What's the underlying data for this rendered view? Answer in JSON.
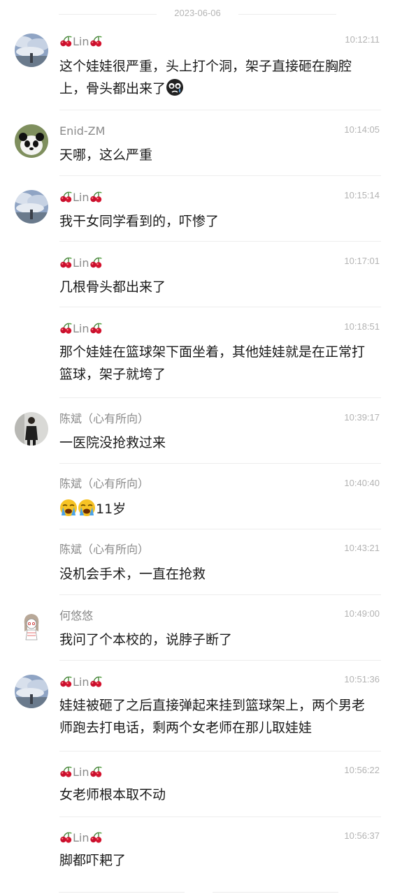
{
  "date_separator": "2023-06-06",
  "messages": [
    {
      "sender": "Lin",
      "time": "10:12:11",
      "avatar": "cloud-landscape-avatar",
      "text": "这个娃娃很严重，头上打个洞，架子直接砸在胸腔上，骨头都出来了",
      "emoji": "crying-face-emoji"
    },
    {
      "sender": "Enid-ZM",
      "time": "10:14:05",
      "avatar": "panda-avatar",
      "text": "天哪，这么严重"
    },
    {
      "sender": "Lin",
      "time": "10:15:14",
      "avatar": "cloud-landscape-avatar",
      "text": "我干女同学看到的，吓惨了"
    },
    {
      "sender": "Lin",
      "time": "10:17:01",
      "text": "几根骨头都出来了"
    },
    {
      "sender": "Lin",
      "time": "10:18:51",
      "text": "那个娃娃在篮球架下面坐着，其他娃娃就是在正常打篮球，架子就垮了"
    },
    {
      "sender": "陈斌（心有所向）",
      "time": "10:39:17",
      "avatar": "person-photo-avatar",
      "text": "一医院没抢救过来"
    },
    {
      "sender": "陈斌（心有所向）",
      "time": "10:40:40",
      "text": "11岁",
      "emoji": "loudly-crying-face-emoji"
    },
    {
      "sender": "陈斌（心有所向）",
      "time": "10:43:21",
      "text": "没机会手术，一直在抢救"
    },
    {
      "sender": "何悠悠",
      "time": "10:49:00",
      "avatar": "cartoon-girl-avatar",
      "text": "我问了个本校的，说脖子断了"
    },
    {
      "sender": "Lin",
      "time": "10:51:36",
      "avatar": "cloud-landscape-avatar",
      "text": "娃娃被砸了之后直接弹起来挂到篮球架上，两个男老师跑去打电话，剩两个女老师在那儿取娃娃"
    },
    {
      "sender": "Lin",
      "time": "10:56:22",
      "text": "女老师根本取不动"
    },
    {
      "sender": "Lin",
      "time": "10:56:37",
      "text": "脚都吓耙了"
    }
  ]
}
